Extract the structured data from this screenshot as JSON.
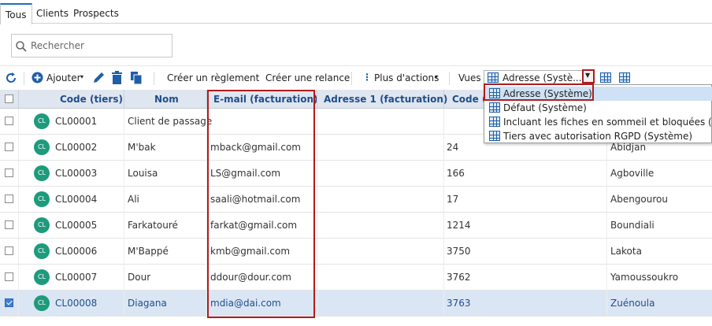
{
  "tabs": [
    {
      "label": "Tous",
      "active": true
    },
    {
      "label": "Clients",
      "active": false
    },
    {
      "label": "Prospects",
      "active": false
    }
  ],
  "search": {
    "placeholder": "Rechercher"
  },
  "toolbar": {
    "add_label": "Ajouter",
    "create_payment": "Créer un règlement",
    "create_reminder": "Créer une relance",
    "more_actions": "Plus d'actions",
    "views_label": "Vues",
    "view_selected": "Adresse (Systè..."
  },
  "columns": {
    "code": "Code (tiers)",
    "name": "Nom",
    "email": "E-mail (facturation)",
    "address1": "Adresse 1 (facturation)",
    "postcode": "Code ("
  },
  "rows": [
    {
      "badge": "CL",
      "code": "CL00001",
      "name": "Client de passage",
      "email": "",
      "address": "",
      "city": "",
      "selected": false
    },
    {
      "badge": "CL",
      "code": "CL00002",
      "name": "M'bak",
      "email": "mback@gmail.com",
      "address": "24",
      "city": "Abidjan",
      "selected": false
    },
    {
      "badge": "CL",
      "code": "CL00003",
      "name": "Louisa",
      "email": "LS@gmail.com",
      "address": "166",
      "city": "Agboville",
      "selected": false
    },
    {
      "badge": "CL",
      "code": "CL00004",
      "name": "Ali",
      "email": "saali@hotmail.com",
      "address": "17",
      "city": "Abengourou",
      "selected": false
    },
    {
      "badge": "CL",
      "code": "CL00005",
      "name": "Farkatouré",
      "email": "farkat@gmail.com",
      "address": "1214",
      "city": "Boundiali",
      "selected": false
    },
    {
      "badge": "CL",
      "code": "CL00006",
      "name": "M'Bappé",
      "email": "kmb@gmail.com",
      "address": "3750",
      "city": "Lakota",
      "selected": false
    },
    {
      "badge": "CL",
      "code": "CL00007",
      "name": "Dour",
      "email": "ddour@dour.com",
      "address": "3762",
      "city": "Yamoussoukro",
      "selected": false
    },
    {
      "badge": "CL",
      "code": "CL00008",
      "name": "Diagana",
      "email": "mdia@dai.com",
      "address": "3763",
      "city": "Zuénoula",
      "selected": true
    }
  ],
  "views_dropdown": {
    "items": [
      "Adresse (Système)",
      "Défaut (Système)",
      "Incluant les fiches en sommeil et bloquées (Système)",
      "Tiers avec autorisation RGPD (Système)"
    ],
    "highlighted": 0
  },
  "colors": {
    "accent": "#1a6fc0",
    "header_text": "#1f4e8c",
    "badge": "#1e9a7c",
    "annotation": "#b01c1c",
    "selected_row": "#dbe6f4"
  }
}
